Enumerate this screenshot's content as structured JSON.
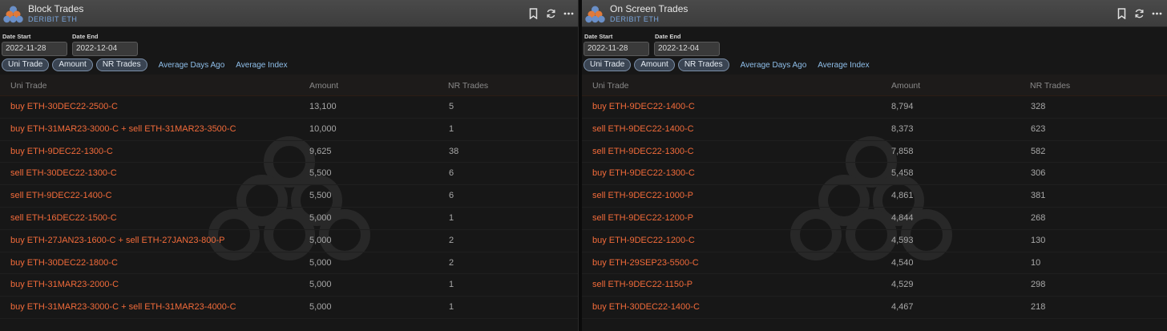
{
  "left": {
    "title": "Block Trades",
    "subtitle": "DERIBIT ETH",
    "date_start_label": "Date Start",
    "date_end_label": "Date End",
    "date_start": "2022-11-28",
    "date_end": "2022-12-04",
    "tabs": [
      "Uni Trade",
      "Amount",
      "NR Trades"
    ],
    "links": [
      "Average Days Ago",
      "Average Index"
    ],
    "columns": [
      "Uni Trade",
      "Amount",
      "NR Trades"
    ],
    "rows": [
      {
        "trade": "buy ETH-30DEC22-2500-C",
        "amount": "13,100",
        "nr": "5"
      },
      {
        "trade": "buy ETH-31MAR23-3000-C + sell ETH-31MAR23-3500-C",
        "amount": "10,000",
        "nr": "1"
      },
      {
        "trade": "buy ETH-9DEC22-1300-C",
        "amount": "9,625",
        "nr": "38"
      },
      {
        "trade": "sell ETH-30DEC22-1300-C",
        "amount": "5,500",
        "nr": "6"
      },
      {
        "trade": "sell ETH-9DEC22-1400-C",
        "amount": "5,500",
        "nr": "6"
      },
      {
        "trade": "sell ETH-16DEC22-1500-C",
        "amount": "5,000",
        "nr": "1"
      },
      {
        "trade": "buy ETH-27JAN23-1600-C + sell ETH-27JAN23-800-P",
        "amount": "5,000",
        "nr": "2"
      },
      {
        "trade": "buy ETH-30DEC22-1800-C",
        "amount": "5,000",
        "nr": "2"
      },
      {
        "trade": "buy ETH-31MAR23-2000-C",
        "amount": "5,000",
        "nr": "1"
      },
      {
        "trade": "buy ETH-31MAR23-3000-C + sell ETH-31MAR23-4000-C",
        "amount": "5,000",
        "nr": "1"
      }
    ]
  },
  "right": {
    "title": "On Screen Trades",
    "subtitle": "DERIBIT ETH",
    "date_start_label": "Date Start",
    "date_end_label": "Date End",
    "date_start": "2022-11-28",
    "date_end": "2022-12-04",
    "tabs": [
      "Uni Trade",
      "Amount",
      "NR Trades"
    ],
    "links": [
      "Average Days Ago",
      "Average Index"
    ],
    "columns": [
      "Uni Trade",
      "Amount",
      "NR Trades"
    ],
    "rows": [
      {
        "trade": "buy ETH-9DEC22-1400-C",
        "amount": "8,794",
        "nr": "328"
      },
      {
        "trade": "sell ETH-9DEC22-1400-C",
        "amount": "8,373",
        "nr": "623"
      },
      {
        "trade": "sell ETH-9DEC22-1300-C",
        "amount": "7,858",
        "nr": "582"
      },
      {
        "trade": "buy ETH-9DEC22-1300-C",
        "amount": "5,458",
        "nr": "306"
      },
      {
        "trade": "sell ETH-9DEC22-1000-P",
        "amount": "4,861",
        "nr": "381"
      },
      {
        "trade": "sell ETH-9DEC22-1200-P",
        "amount": "4,844",
        "nr": "268"
      },
      {
        "trade": "buy ETH-9DEC22-1200-C",
        "amount": "4,593",
        "nr": "130"
      },
      {
        "trade": "buy ETH-29SEP23-5500-C",
        "amount": "4,540",
        "nr": "10"
      },
      {
        "trade": "sell ETH-9DEC22-1150-P",
        "amount": "4,529",
        "nr": "298"
      },
      {
        "trade": "buy ETH-30DEC22-1400-C",
        "amount": "4,467",
        "nr": "218"
      }
    ]
  },
  "icons": [
    "app-logo-icon",
    "bookmark-icon",
    "refresh-icon",
    "more-icon"
  ],
  "colors": {
    "trade_text": "#f26b3a",
    "header_bg": "#444444",
    "link": "#8fbfea",
    "subtitle": "#7aa6dd"
  }
}
